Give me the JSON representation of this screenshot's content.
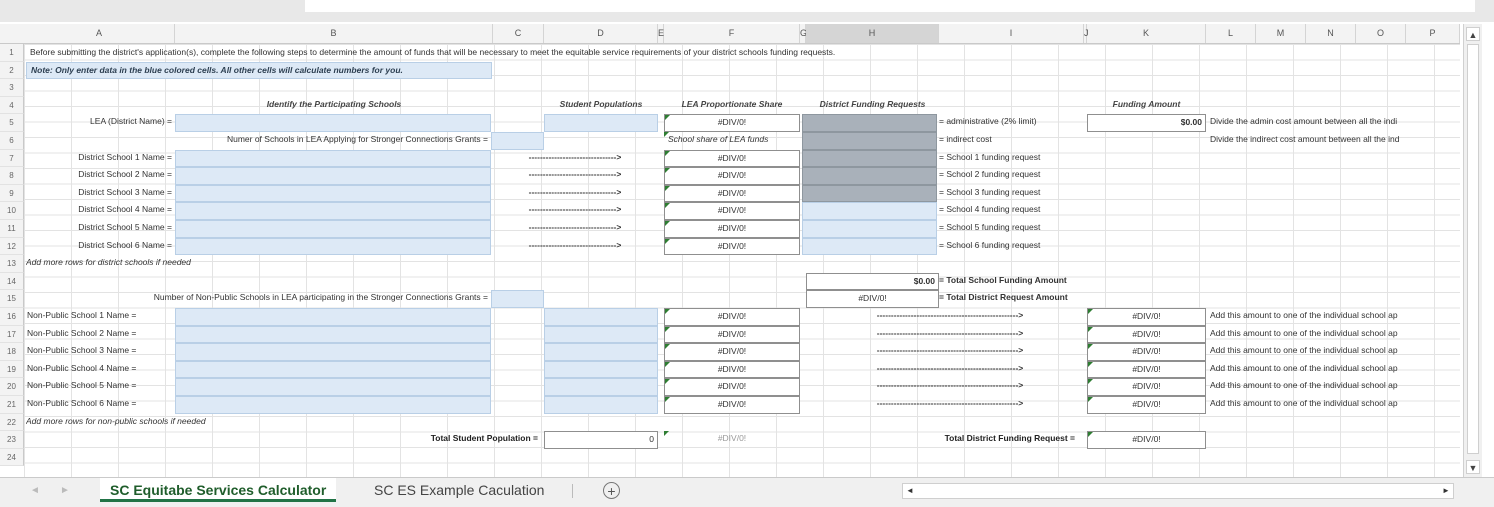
{
  "columns": [
    "A",
    "B",
    "C",
    "D",
    "E",
    "F",
    "G",
    "H",
    "I",
    "J",
    "K",
    "L",
    "M",
    "N",
    "O",
    "P"
  ],
  "rows": [
    "1",
    "2",
    "3",
    "4",
    "5",
    "6",
    "7",
    "8",
    "9",
    "10",
    "11",
    "12",
    "13",
    "14",
    "15",
    "16",
    "17",
    "18",
    "19",
    "20",
    "21",
    "22",
    "23",
    "24"
  ],
  "sheet": {
    "intro": "Before submitting the district's application(s), complete the following steps to determine the amount of funds that will be necessary to meet the equitable service requirements of your district schools funding requests.",
    "note": "Note:  Only enter data in the blue colored cells.  All other cells will calculate numbers for you.",
    "hdr_identify": "Identify the Participating Schools",
    "hdr_students": "Student Populations",
    "hdr_lea_share": "LEA Proportionate Share",
    "hdr_district_req": "District Funding Requests",
    "hdr_funding_amt": "Funding Amount",
    "lea_name_label": "LEA (District Name) =",
    "num_schools_label": "Numer of Schools in LEA Applying for Stronger Connections Grants =",
    "school_share_label": "School share of LEA funds",
    "lea_share_value": "#DIV/0!",
    "admin_label": "= administrative (2% limit)",
    "indirect_label": "= indirect cost",
    "admin_amount": "$0.00",
    "admin_note": "Divide the admin cost amount between all the indi",
    "indirect_note": "Divide the indirect cost amount between all the ind",
    "arrow_short": "------------------------------->",
    "arrow_long": "-------------------------------------------------->",
    "div0": "#DIV/0!",
    "district_schools": [
      {
        "label": "District School 1 Name =",
        "request": "= School 1 funding request"
      },
      {
        "label": "District School 2 Name =",
        "request": "= School 2 funding request"
      },
      {
        "label": "District School 3 Name =",
        "request": "= School 3 funding request"
      },
      {
        "label": "District School 4 Name =",
        "request": "= School 4 funding request"
      },
      {
        "label": "District School 5 Name =",
        "request": "= School 5 funding request"
      },
      {
        "label": "District School 6 Name =",
        "request": "= School 6 funding request"
      }
    ],
    "add_district_rows": "Add more rows for district schools if needed",
    "total_school_funding_value": "$0.00",
    "total_school_funding_label": "= Total School Funding Amount",
    "nonpublic_count_label": "Number of Non-Public Schools in LEA participating in the Stronger Connections Grants =",
    "total_district_request_value": "#DIV/0!",
    "total_district_request_label": "= Total District Request Amount",
    "nonpublic_schools": [
      {
        "label": "Non-Public School 1 Name ="
      },
      {
        "label": "Non-Public School 2 Name ="
      },
      {
        "label": "Non-Public School 3 Name ="
      },
      {
        "label": "Non-Public School 4 Name ="
      },
      {
        "label": "Non-Public School 5 Name ="
      },
      {
        "label": "Non-Public School 6 Name ="
      }
    ],
    "nonpublic_note": "Add this amount to one of the individual school ap",
    "add_nonpublic_rows": "Add more rows for non-public schools if needed",
    "total_student_label": "Total Student Population =",
    "total_student_value": "0",
    "total_district_funding_label": "Total District Funding Request =",
    "total_district_funding_value": "#DIV/0!"
  },
  "tabs": {
    "active": "SC Equitabe Services Calculator",
    "second": "SC ES Example Caculation",
    "add_symbol": "+"
  },
  "scroll": {
    "up": "▲",
    "down": "▼",
    "left": "◄",
    "right": "►"
  },
  "nav": {
    "prev": "◄",
    "next": "►"
  },
  "colors": {
    "blue_cell": "#dde9f6",
    "gray_cell": "#a9b1ba",
    "active_tab_text": "#1f5d2b"
  }
}
